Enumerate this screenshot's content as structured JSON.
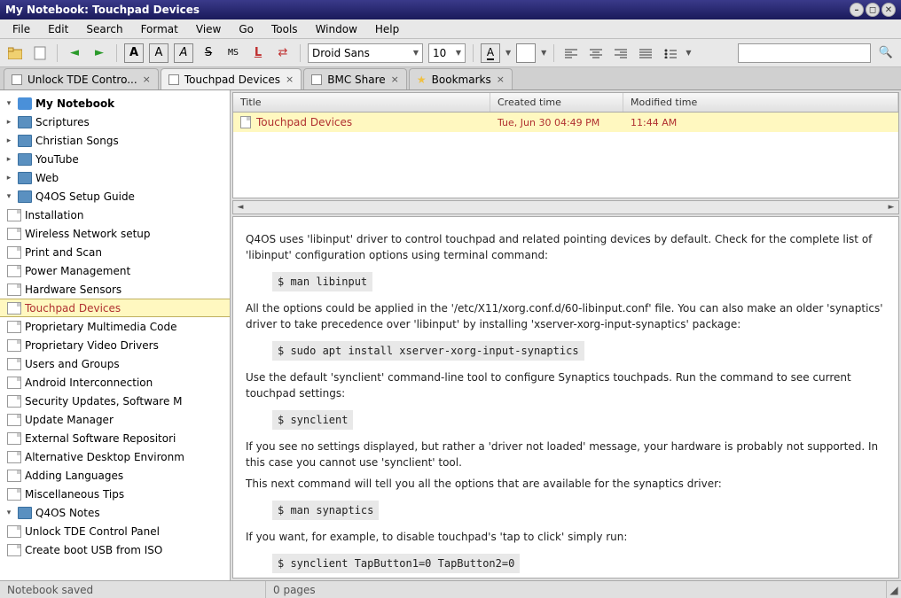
{
  "window": {
    "title": "My Notebook: Touchpad Devices"
  },
  "menu": [
    "File",
    "Edit",
    "Search",
    "Format",
    "View",
    "Go",
    "Tools",
    "Window",
    "Help"
  ],
  "toolbar": {
    "font": "Droid Sans",
    "size": "10"
  },
  "tabs": [
    {
      "label": "Unlock TDE Contro...",
      "active": false
    },
    {
      "label": "Touchpad Devices",
      "active": true
    },
    {
      "label": "BMC Share",
      "active": false
    },
    {
      "label": "Bookmarks",
      "active": false,
      "star": true
    }
  ],
  "tree": {
    "root": "My Notebook",
    "folders1": [
      {
        "label": "Scriptures",
        "expanded": false
      },
      {
        "label": "Christian Songs",
        "expanded": false
      },
      {
        "label": "YouTube",
        "expanded": false
      },
      {
        "label": "Web",
        "expanded": false
      }
    ],
    "setup_guide": {
      "label": "Q4OS Setup Guide",
      "expanded": true
    },
    "setup_pages": [
      "Installation",
      "Wireless Network setup",
      "Print and Scan",
      "Power Management",
      "Hardware Sensors",
      "Touchpad Devices",
      "Proprietary Multimedia Code",
      "Proprietary Video Drivers",
      "Users and Groups",
      "Android Interconnection",
      "Security Updates, Software M",
      "Update Manager",
      "External Software Repositori",
      "Alternative Desktop Environm",
      "Adding Languages",
      "Miscellaneous Tips"
    ],
    "selected_page_index": 5,
    "notes": {
      "label": "Q4OS Notes",
      "expanded": true
    },
    "notes_pages": [
      "Unlock TDE Control Panel",
      "Create boot USB from ISO"
    ]
  },
  "list": {
    "cols": {
      "title": "Title",
      "created": "Created time",
      "modified": "Modified time"
    },
    "rows": [
      {
        "title": "Touchpad Devices",
        "created": "Tue, Jun 30 04:49 PM",
        "modified": "11:44 AM"
      }
    ]
  },
  "doc": {
    "p1": "Q4OS uses 'libinput' driver to control touchpad and related pointing devices by default. Check for the complete list of 'libinput' configuration options using terminal command:",
    "c1": "$ man libinput",
    "p2": "All the options could be applied in the '/etc/X11/xorg.conf.d/60-libinput.conf' file. You can also make an older 'synaptics' driver to take precedence over 'libinput' by installing 'xserver-xorg-input-synaptics' package:",
    "c2": "$ sudo apt install xserver-xorg-input-synaptics",
    "p3": "Use the default 'synclient' command-line tool to configure Synaptics touchpads. Run the command to see current touchpad settings:",
    "c3": "$ synclient",
    "p4": "If you see no settings displayed, but rather a 'driver not loaded' message, your hardware is probably not supported. In this case you cannot use 'synclient' tool.",
    "p5": "This next command will tell you all the options that are available for the synaptics driver:",
    "c4": "$ man synaptics",
    "p6": "If you want, for example, to disable touchpad's 'tap to click' simply run:",
    "c5": "$ synclient TapButton1=0 TapButton2=0"
  },
  "status": {
    "left": "Notebook saved",
    "mid": "0 pages"
  }
}
